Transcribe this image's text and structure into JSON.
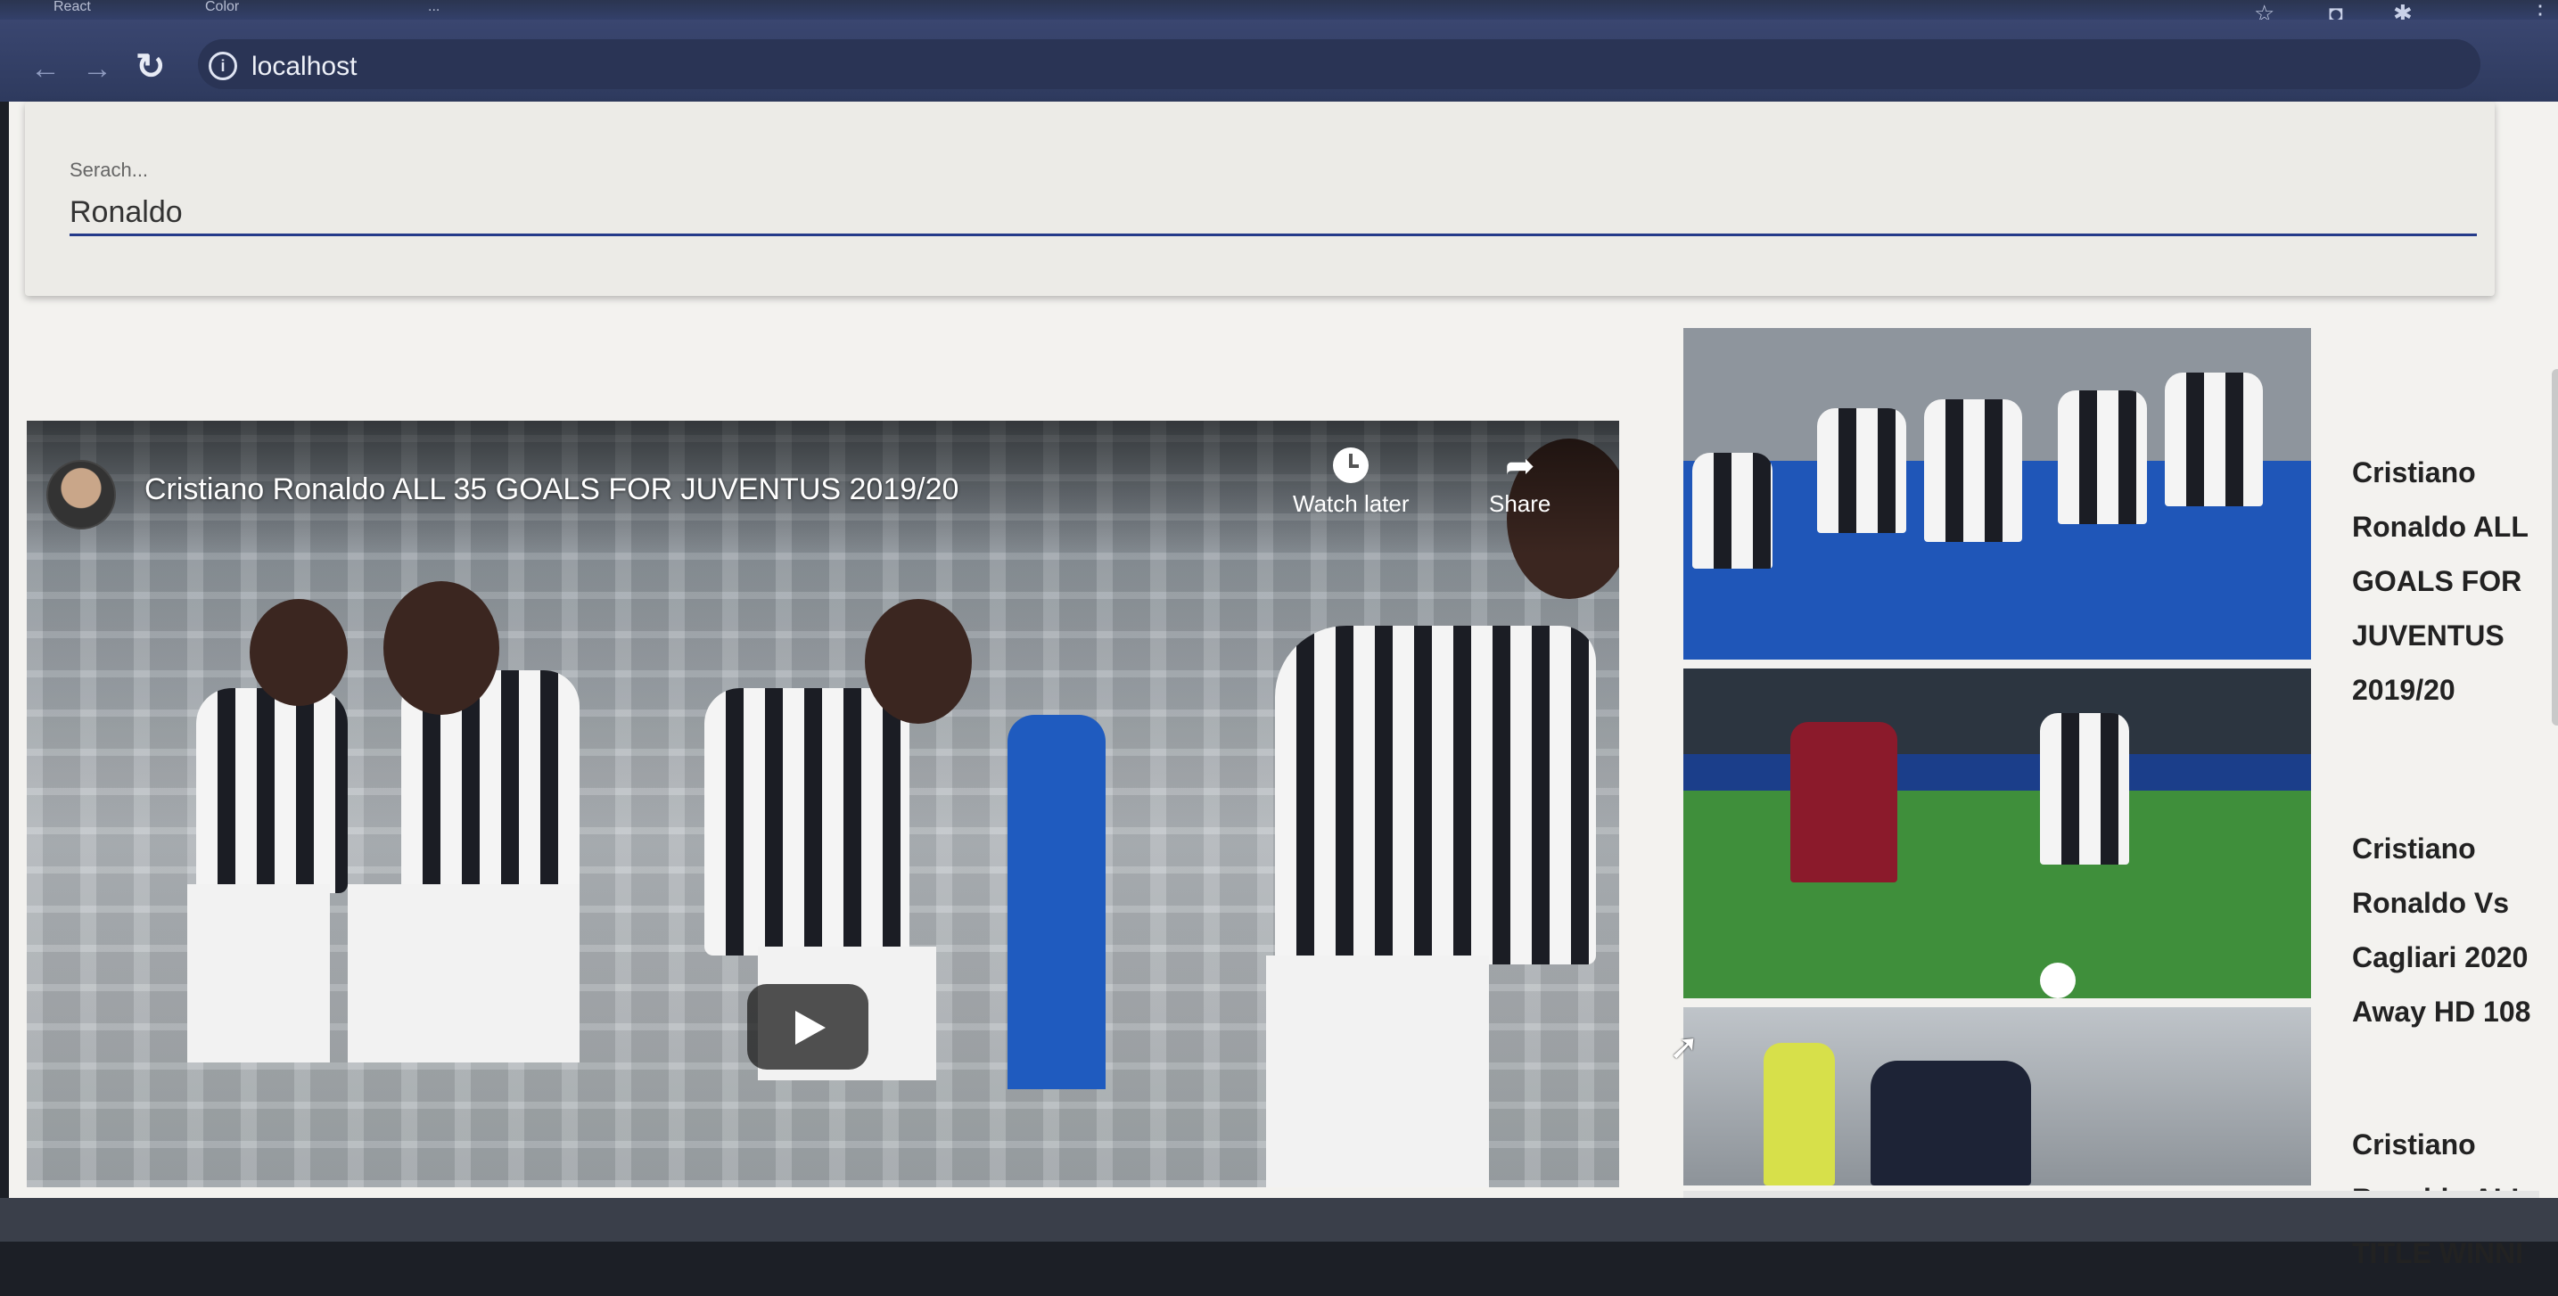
{
  "browser": {
    "tabs": [
      {
        "label": "React"
      },
      {
        "label": "Color"
      },
      {
        "label": "..."
      }
    ],
    "url": "localhost"
  },
  "search": {
    "label": "Serach...",
    "value": "Ronaldo"
  },
  "video": {
    "title": "Cristiano Ronaldo ALL 35 GOALS FOR JUVENTUS 2019/20",
    "watch_later": "Watch later",
    "share": "Share"
  },
  "results": [
    {
      "title": "Cristiano\nRonaldo ALL\nGOALS FOR\nJUVENTUS\n2019/20"
    },
    {
      "title": "Cristiano\nRonaldo Vs\nCagliari 2020\nAway HD 108"
    },
    {
      "title": "Cristiano\nRonaldo ALL\nTITLE WINNI"
    }
  ],
  "colors": {
    "search_underline": "#243a8a",
    "browser_chrome": "#33406a",
    "page_bg": "#f3f2ef"
  }
}
